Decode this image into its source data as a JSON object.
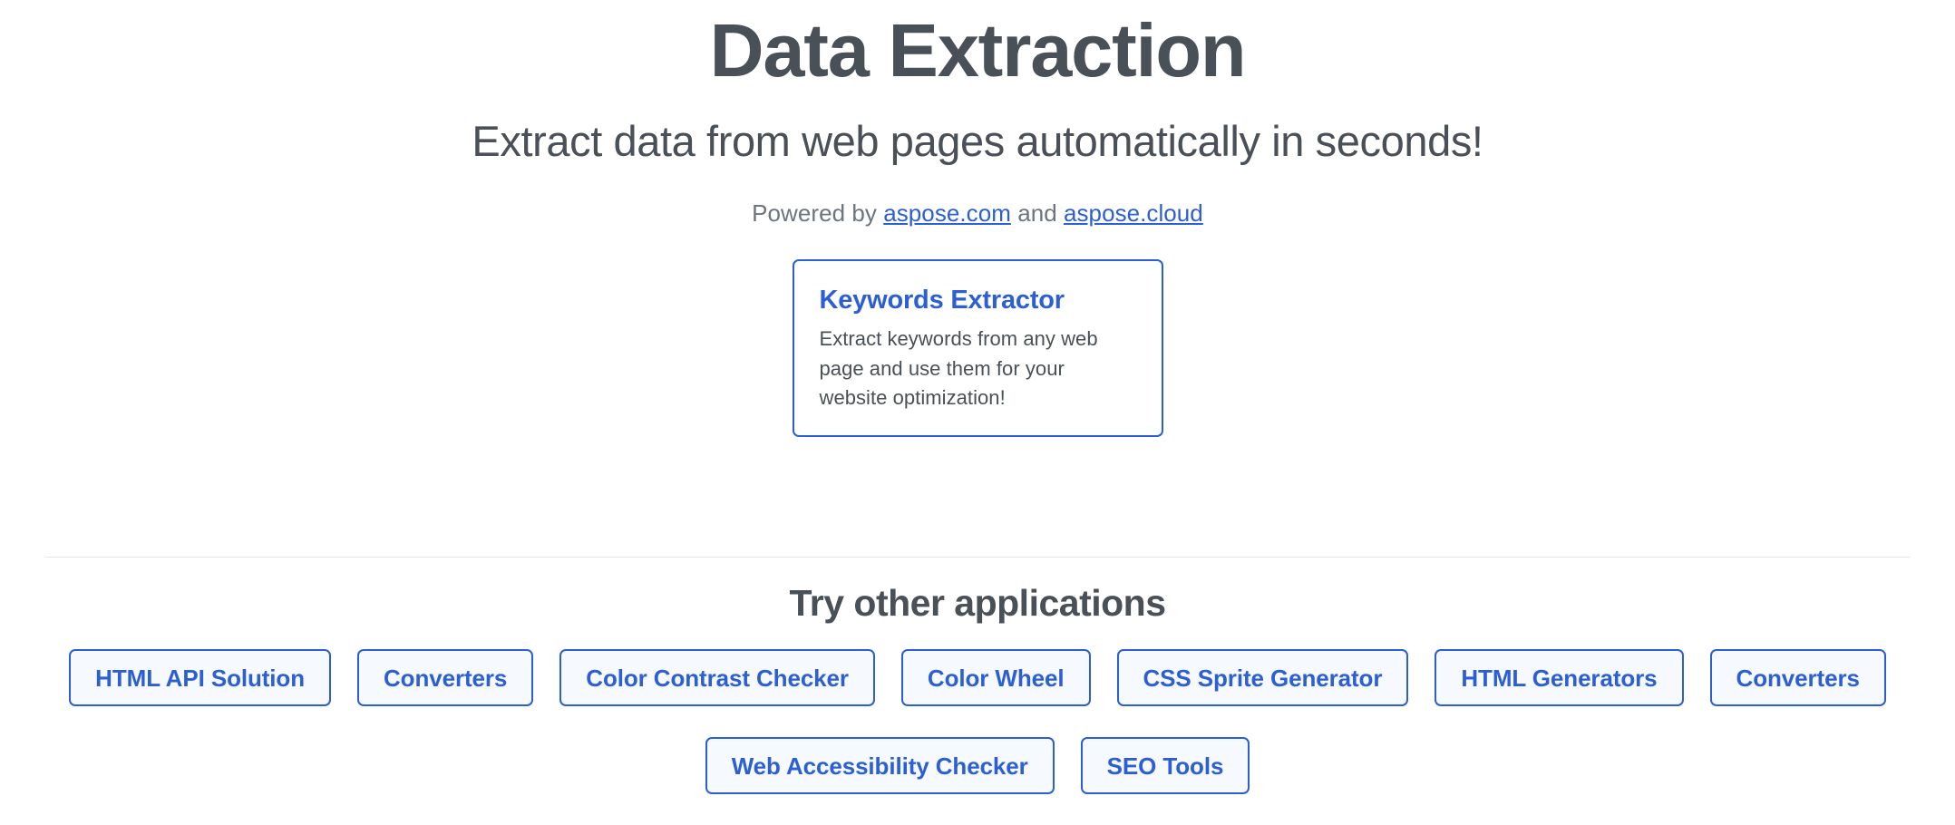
{
  "hero": {
    "title": "Data Extraction",
    "subtitle": "Extract data from web pages automatically in seconds!",
    "powered_by_prefix": "Powered by ",
    "powered_by_link1": "aspose.com",
    "powered_by_conjunction": " and ",
    "powered_by_link2": "aspose.cloud"
  },
  "feature_card": {
    "title": "Keywords Extractor",
    "description": "Extract keywords from any web page and use them for your website optimization!"
  },
  "other_apps": {
    "title": "Try other applications",
    "row1": [
      {
        "label": "HTML API Solution"
      },
      {
        "label": "Converters"
      },
      {
        "label": "Color Contrast Checker"
      },
      {
        "label": "Color Wheel"
      },
      {
        "label": "CSS Sprite Generator"
      },
      {
        "label": "HTML Generators"
      },
      {
        "label": "Converters"
      }
    ],
    "row2": [
      {
        "label": "Web Accessibility Checker"
      },
      {
        "label": "SEO Tools"
      }
    ]
  },
  "colors": {
    "accent_blue": "#2c5fd3",
    "heading_gray": "#495057",
    "muted_gray": "#6c757d",
    "button_fill": "#f6f9fd",
    "divider": "#e6e7e9",
    "background": "#ffffff"
  }
}
